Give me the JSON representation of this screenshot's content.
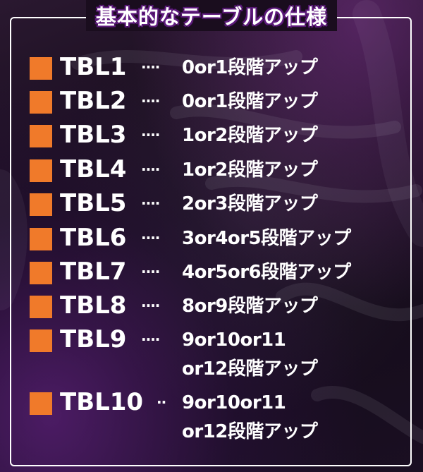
{
  "title": "基本的なテーブルの仕様",
  "colors": {
    "marker": "#f07a2a",
    "text": "#ffffff",
    "accent": "#5a1a78"
  },
  "rows": [
    {
      "name": "TBL1",
      "dots": "····",
      "value": "0or1段階アップ"
    },
    {
      "name": "TBL2",
      "dots": "····",
      "value": "0or1段階アップ"
    },
    {
      "name": "TBL3",
      "dots": "····",
      "value": "1or2段階アップ"
    },
    {
      "name": "TBL4",
      "dots": "····",
      "value": "1or2段階アップ"
    },
    {
      "name": "TBL5",
      "dots": "····",
      "value": "2or3段階アップ"
    },
    {
      "name": "TBL6",
      "dots": "····",
      "value": "3or4or5段階アップ"
    },
    {
      "name": "TBL7",
      "dots": "····",
      "value": "4or5or6段階アップ"
    },
    {
      "name": "TBL8",
      "dots": "····",
      "value": "8or9段階アップ"
    },
    {
      "name": "TBL9",
      "dots": "····",
      "value": "9or10or11",
      "value_line2": "or12段階アップ"
    },
    {
      "name": "TBL10",
      "dots": "··",
      "value": "9or10or11",
      "value_line2": "or12段階アップ"
    }
  ]
}
